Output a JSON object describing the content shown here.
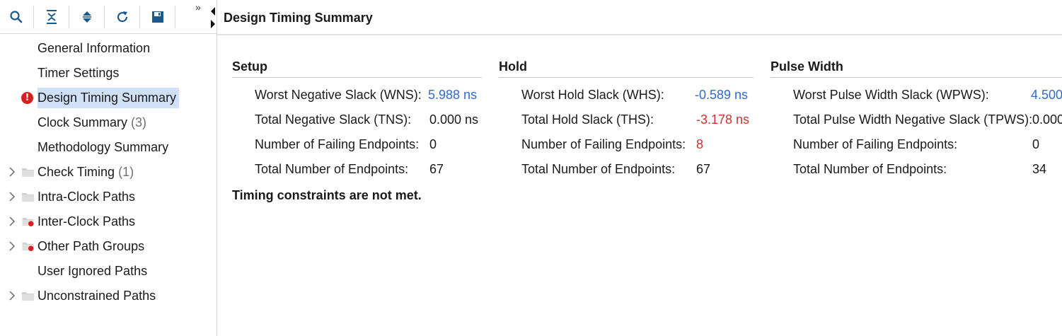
{
  "toolbar": {
    "buttons": [
      "search-icon",
      "collapse-all-icon",
      "expand-all-icon",
      "refresh-icon",
      "save-icon"
    ],
    "more": "»"
  },
  "tree": {
    "items": [
      {
        "label": "General Information",
        "count": "",
        "expandable": false,
        "icon": "none"
      },
      {
        "label": "Timer Settings",
        "count": "",
        "expandable": false,
        "icon": "none"
      },
      {
        "label": "Design Timing Summary",
        "count": "",
        "expandable": false,
        "icon": "error",
        "selected": true
      },
      {
        "label": "Clock Summary",
        "count": "(3)",
        "expandable": false,
        "icon": "none"
      },
      {
        "label": "Methodology Summary",
        "count": "",
        "expandable": false,
        "icon": "none"
      },
      {
        "label": "Check Timing",
        "count": "(1)",
        "expandable": true,
        "icon": "folder"
      },
      {
        "label": "Intra-Clock Paths",
        "count": "",
        "expandable": true,
        "icon": "folder"
      },
      {
        "label": "Inter-Clock Paths",
        "count": "",
        "expandable": true,
        "icon": "folder-error"
      },
      {
        "label": "Other Path Groups",
        "count": "",
        "expandable": true,
        "icon": "folder-error"
      },
      {
        "label": "User Ignored Paths",
        "count": "",
        "expandable": false,
        "icon": "none"
      },
      {
        "label": "Unconstrained Paths",
        "count": "",
        "expandable": true,
        "icon": "folder"
      }
    ]
  },
  "content": {
    "title": "Design Timing Summary",
    "setup": {
      "title": "Setup",
      "rows": [
        {
          "label": "Worst Negative Slack (WNS):",
          "value": "5.988 ns",
          "style": "link"
        },
        {
          "label": "Total Negative Slack (TNS):",
          "value": "0.000 ns",
          "style": "normal"
        },
        {
          "label": "Number of Failing Endpoints:",
          "value": "0",
          "style": "normal"
        },
        {
          "label": "Total Number of Endpoints:",
          "value": "67",
          "style": "normal"
        }
      ]
    },
    "hold": {
      "title": "Hold",
      "rows": [
        {
          "label": "Worst Hold Slack (WHS):",
          "value": "-0.589 ns",
          "style": "link"
        },
        {
          "label": "Total Hold Slack (THS):",
          "value": "-3.178 ns",
          "style": "bad"
        },
        {
          "label": "Number of Failing Endpoints:",
          "value": "8",
          "style": "bad"
        },
        {
          "label": "Total Number of Endpoints:",
          "value": "67",
          "style": "normal"
        }
      ]
    },
    "pulse_width": {
      "title": "Pulse Width",
      "rows": [
        {
          "label": "Worst Pulse Width Slack (WPWS):",
          "value": "4.500",
          "style": "link"
        },
        {
          "label": "Total Pulse Width Negative Slack (TPWS):",
          "value": "0.000",
          "style": "normal"
        },
        {
          "label": "Number of Failing Endpoints:",
          "value": "0",
          "style": "normal"
        },
        {
          "label": "Total Number of Endpoints:",
          "value": "34",
          "style": "normal"
        }
      ]
    },
    "status": "Timing constraints are not met."
  },
  "colors": {
    "link": "#2f6bcc",
    "error": "#d0312d",
    "selection": "#cfe0f7",
    "error_icon": "#d6201f"
  }
}
